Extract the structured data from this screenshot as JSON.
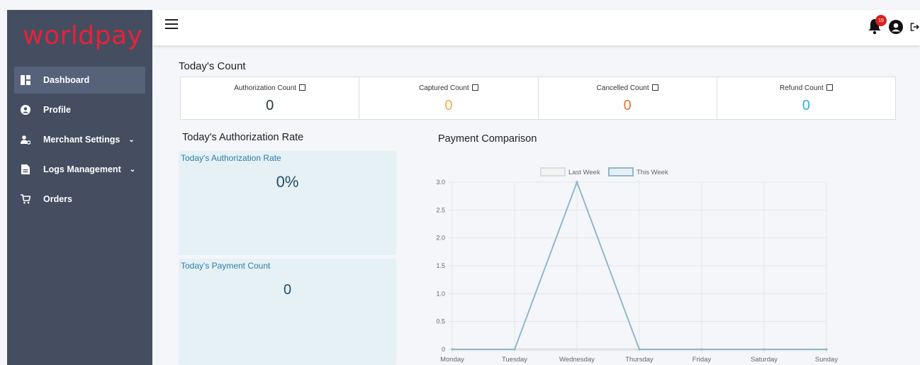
{
  "brand": {
    "logo_text": "worldpay",
    "color": "#e8213a"
  },
  "sidebar": {
    "items": [
      {
        "label": "Dashboard",
        "icon": "dashboard-icon",
        "active": true
      },
      {
        "label": "Profile",
        "icon": "user-circle-icon"
      },
      {
        "label": "Merchant Settings",
        "icon": "users-cog-icon",
        "has_submenu": true
      },
      {
        "label": "Logs Management",
        "icon": "file-icon",
        "has_submenu": true
      },
      {
        "label": "Orders",
        "icon": "cart-icon"
      }
    ]
  },
  "header": {
    "notification_count": "19"
  },
  "todays_count": {
    "title": "Today's Count",
    "cards": [
      {
        "label": "Authorization Count",
        "value": "0",
        "color": "#1a3d2a"
      },
      {
        "label": "Captured Count",
        "value": "0",
        "color": "#f0ad4e"
      },
      {
        "label": "Cancelled Count",
        "value": "0",
        "color": "#e8702a"
      },
      {
        "label": "Refund Count",
        "value": "0",
        "color": "#2bb0e0"
      }
    ]
  },
  "auth_rate": {
    "title": "Today's Authorization Rate",
    "rate_label": "Today's Authorization Rate",
    "rate_value": "0%",
    "payment_label": "Today's Payment Count",
    "payment_value": "0"
  },
  "payment_comparison": {
    "title": "Payment Comparison"
  },
  "chart_data": {
    "type": "line",
    "categories": [
      "Monday",
      "Tuesday",
      "Wednesday",
      "Thursday",
      "Friday",
      "Saturday",
      "Sunday"
    ],
    "series": [
      {
        "name": "Last Week",
        "values": [
          0,
          0,
          0,
          0,
          0,
          0,
          0
        ],
        "color": "#e0e0e0"
      },
      {
        "name": "This Week",
        "values": [
          0,
          0,
          3,
          0,
          0,
          0,
          0
        ],
        "color": "#93b7cc"
      }
    ],
    "ylim": [
      0,
      3.0
    ],
    "yticks": [
      "0",
      "0.5",
      "1.0",
      "1.5",
      "2.0",
      "2.5",
      "3.0"
    ],
    "legend": "top",
    "grid": true
  }
}
